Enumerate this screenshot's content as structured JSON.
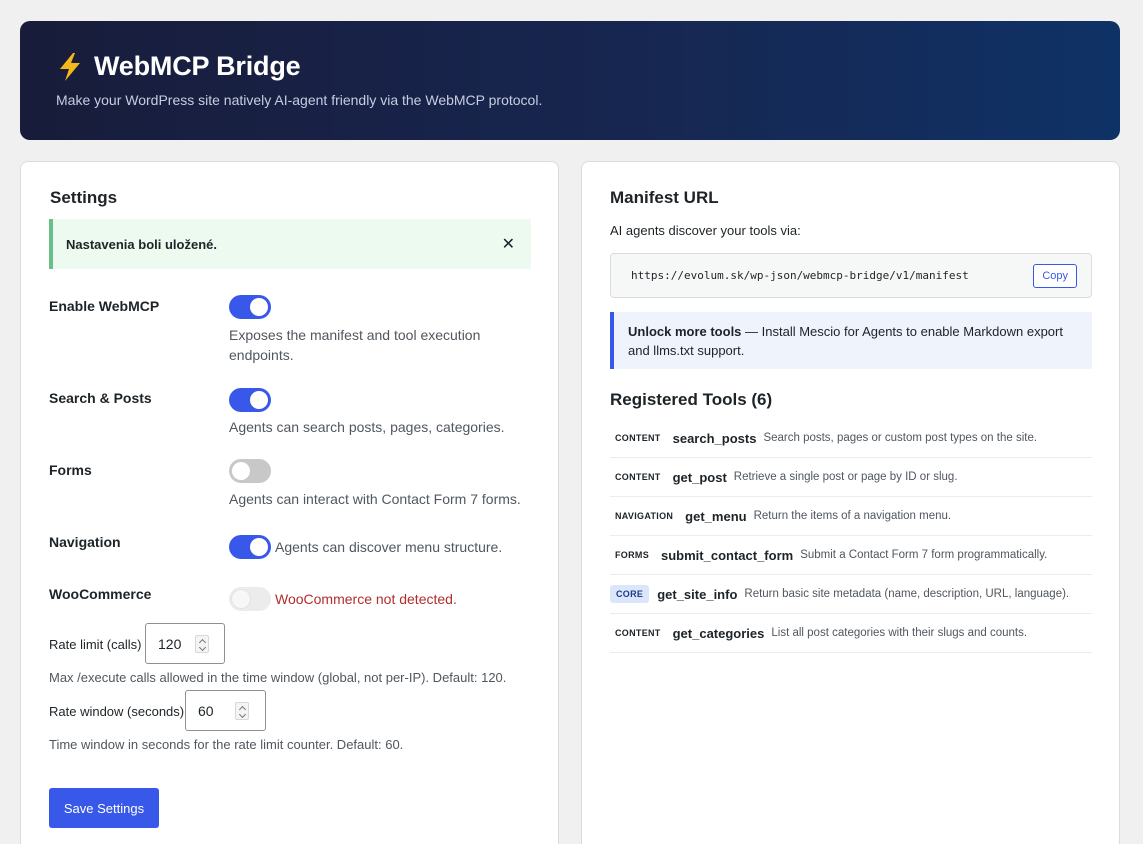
{
  "header": {
    "title": "WebMCP Bridge",
    "subtitle": "Make your WordPress site natively AI-agent friendly via the WebMCP protocol.",
    "icon": "lightning-bolt-icon",
    "gradient_colors": [
      "#181c3a",
      "#0f3266"
    ],
    "bolt_color": "#f5b81b"
  },
  "settings": {
    "title": "Settings",
    "notice": "Nastavenia boli uložené.",
    "rows": {
      "webmcp": {
        "label": "Enable WebMCP",
        "enabled": true,
        "description": "Exposes the manifest and tool execution endpoints."
      },
      "search": {
        "label": "Search & Posts",
        "enabled": true,
        "description": "Agents can search posts, pages, categories."
      },
      "forms": {
        "label": "Forms",
        "enabled": false,
        "description": "Agents can interact with Contact Form 7 forms."
      },
      "navigation": {
        "label": "Navigation",
        "enabled": true,
        "description": "Agents can discover menu structure."
      },
      "woocommerce": {
        "label": "WooCommerce",
        "enabled": false,
        "disabled": true,
        "description": "WooCommerce not detected."
      }
    },
    "rate_limit": {
      "label": "Rate limit (calls)",
      "value": "120",
      "help": "Max /execute calls allowed in the time window (global, not per-IP). Default: 120."
    },
    "rate_window": {
      "label": "Rate window (seconds)",
      "value": "60",
      "help": "Time window in seconds for the rate limit counter. Default: 60."
    },
    "save_label": "Save Settings",
    "accent_color": "#3858e9"
  },
  "manifest": {
    "title": "Manifest URL",
    "intro": "AI agents discover your tools via:",
    "url": "https://evolum.sk/wp-json/webmcp-bridge/v1/manifest",
    "copy_label": "Copy",
    "upsell_bold": "Unlock more tools",
    "upsell_text": " — Install Mescio for Agents to enable Markdown export and llms.txt support."
  },
  "tools": {
    "title": "Registered Tools (6)",
    "items": [
      {
        "category": "CONTENT",
        "name": "search_posts",
        "description": "Search posts, pages or custom post types on the site."
      },
      {
        "category": "CONTENT",
        "name": "get_post",
        "description": "Retrieve a single post or page by ID or slug."
      },
      {
        "category": "NAVIGATION",
        "name": "get_menu",
        "description": "Return the items of a navigation menu."
      },
      {
        "category": "FORMS",
        "name": "submit_contact_form",
        "description": "Submit a Contact Form 7 form programmatically."
      },
      {
        "category": "CORE",
        "name": "get_site_info",
        "description": "Return basic site metadata (name, description, URL, language)."
      },
      {
        "category": "CONTENT",
        "name": "get_categories",
        "description": "List all post categories with their slugs and counts."
      }
    ]
  }
}
